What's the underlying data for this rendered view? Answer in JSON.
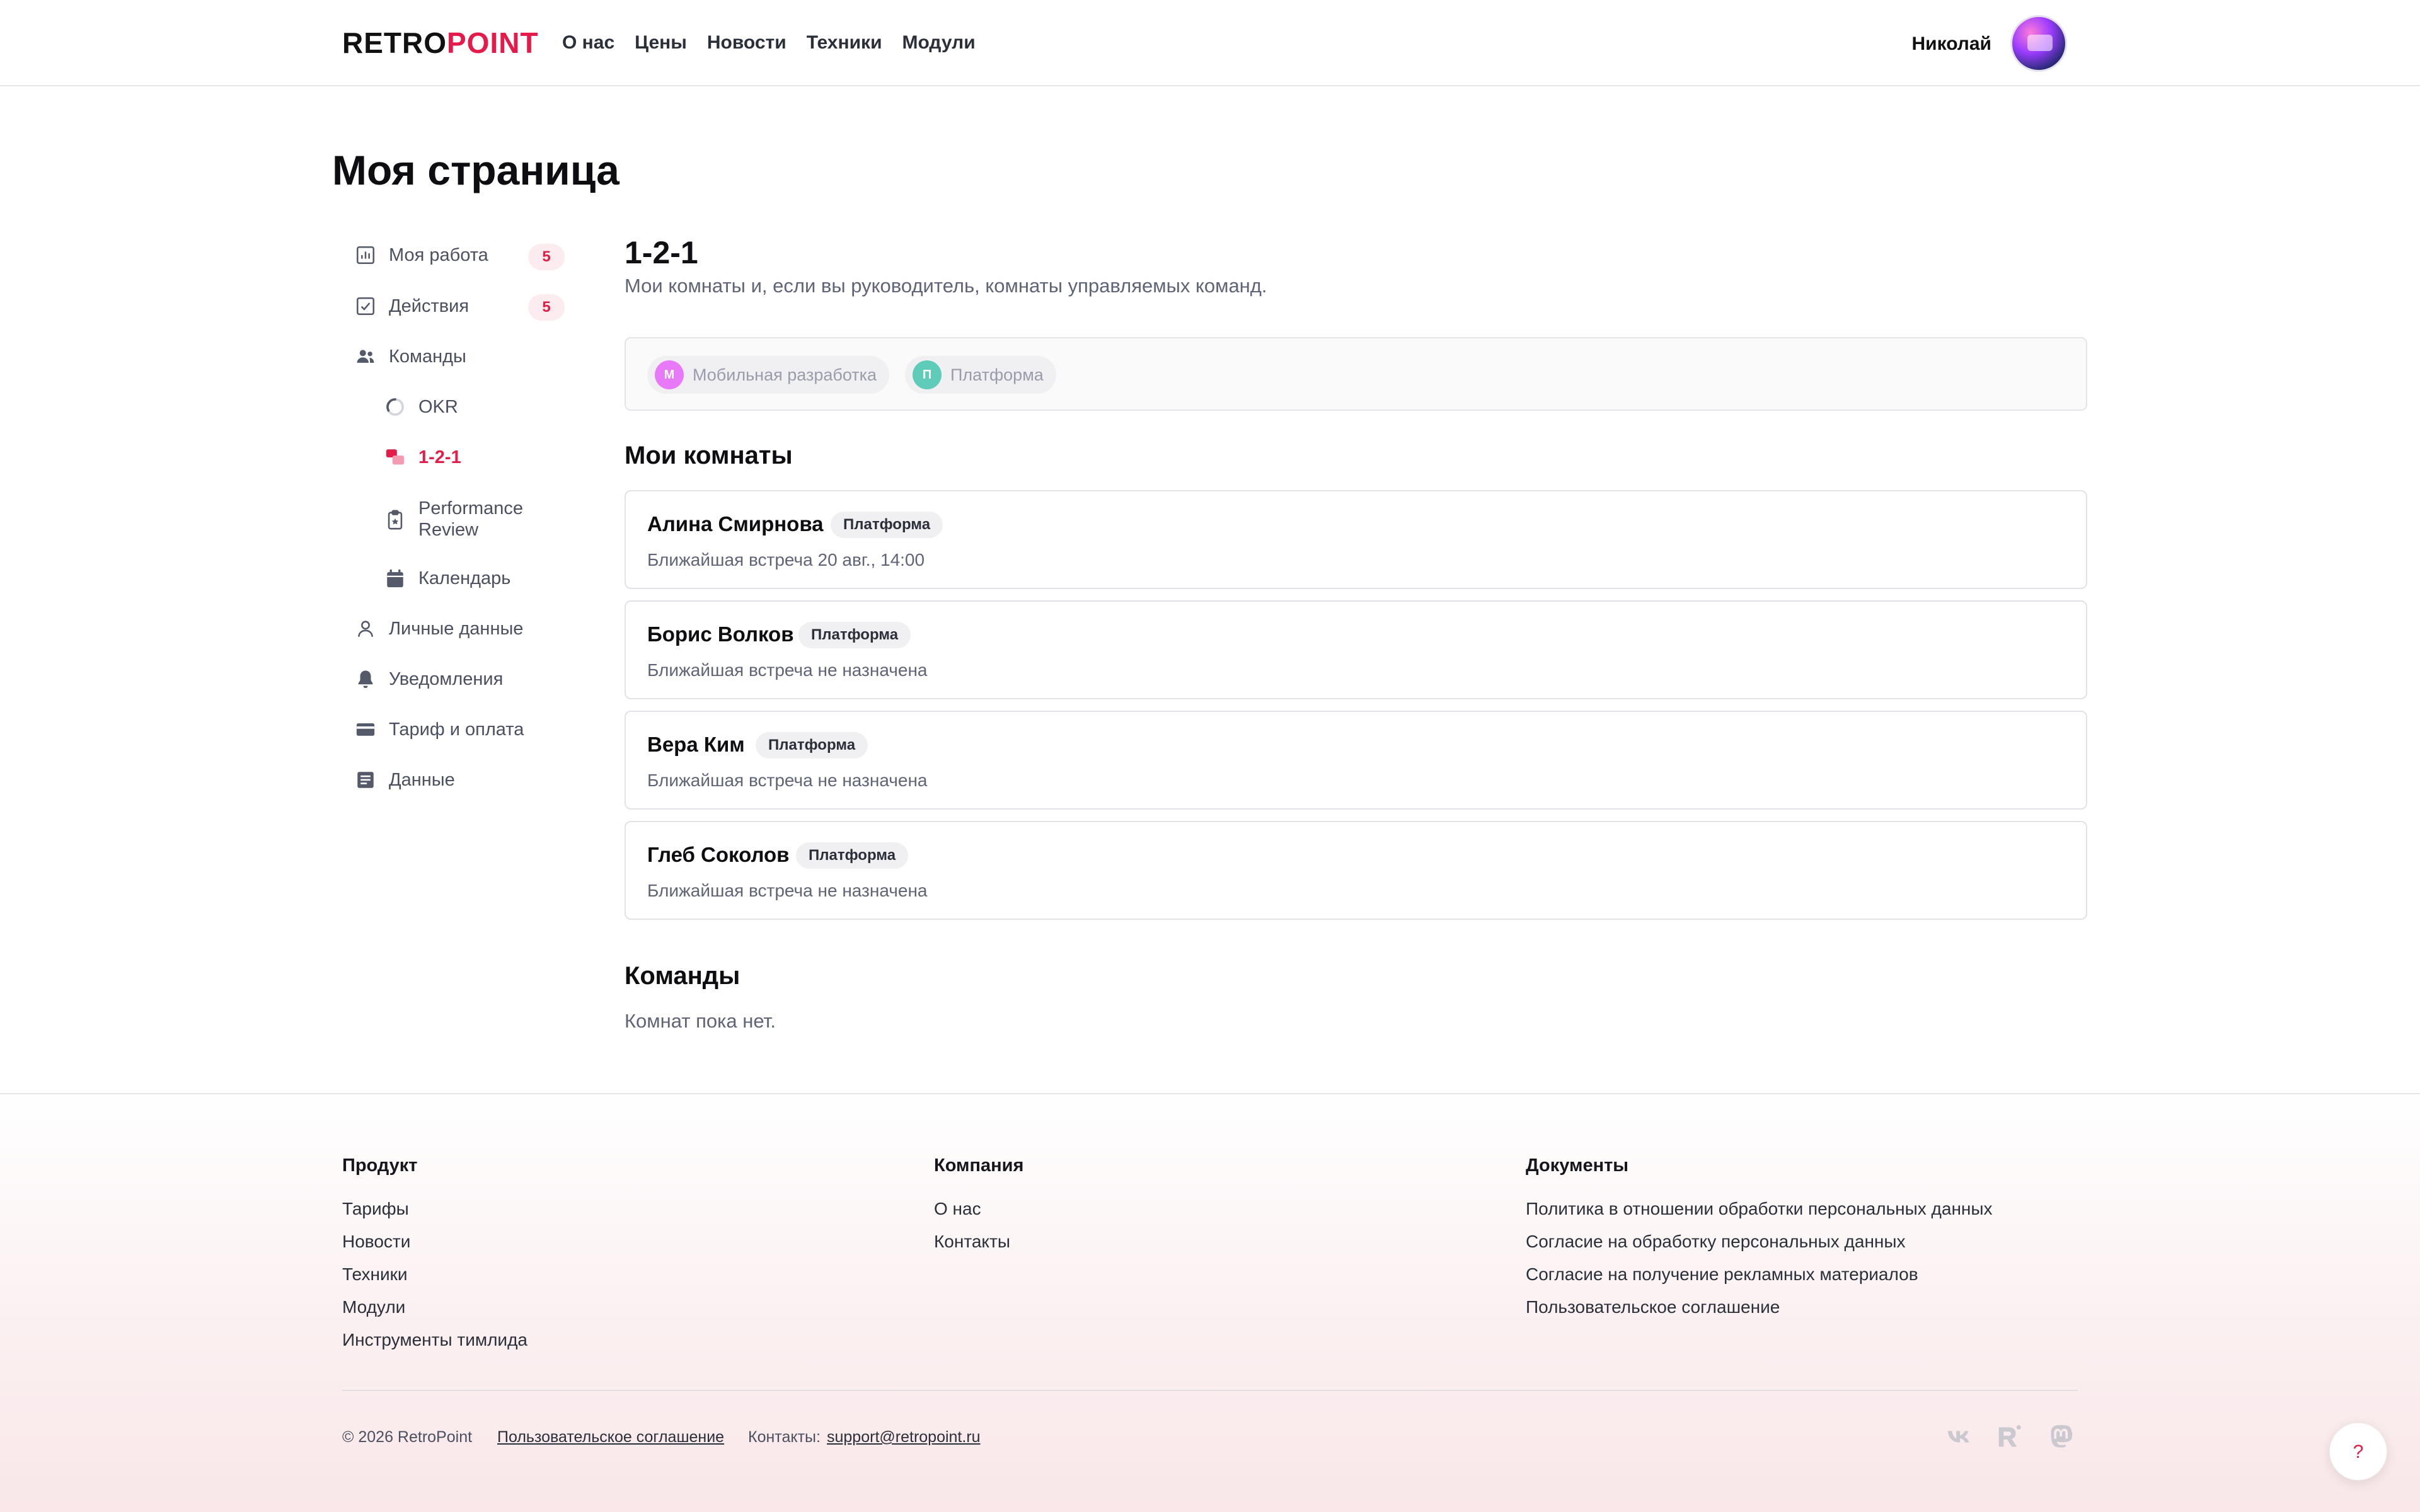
{
  "header": {
    "logo_part1": "RETRO",
    "logo_part2": "POINT",
    "nav": [
      "О нас",
      "Цены",
      "Новости",
      "Техники",
      "Модули"
    ],
    "user_name": "Николай"
  },
  "page_title": "Моя страница",
  "sidebar": {
    "items": [
      {
        "label": "Моя работа",
        "badge": "5",
        "icon": "bar-chart-icon"
      },
      {
        "label": "Действия",
        "badge": "5",
        "icon": "checkbox-icon"
      },
      {
        "label": "Команды",
        "icon": "people-icon"
      },
      {
        "label": "OKR",
        "icon": "progress-ring-icon"
      },
      {
        "label": "1-2-1",
        "icon": "chat-bubbles-icon",
        "active": true
      },
      {
        "label": "Performance Review",
        "icon": "clipboard-star-icon"
      },
      {
        "label": "Календарь",
        "icon": "calendar-icon"
      },
      {
        "label": "Личные данные",
        "icon": "person-icon"
      },
      {
        "label": "Уведомления",
        "icon": "bell-icon"
      },
      {
        "label": "Тариф и оплата",
        "icon": "credit-card-icon"
      },
      {
        "label": "Данные",
        "icon": "document-icon"
      }
    ]
  },
  "main": {
    "title": "1-2-1",
    "description": "Мои комнаты и, если вы руководитель, комнаты управляемых команд.",
    "filters": [
      {
        "initial": "М",
        "label": "Мобильная разработка",
        "color": "#e879f9"
      },
      {
        "initial": "П",
        "label": "Платформа",
        "color": "#5eccb8"
      }
    ],
    "my_rooms_title": "Мои комнаты",
    "rooms": [
      {
        "name": "Алина Смирнова",
        "tag": "Платформа",
        "meeting": "Ближайшая встреча 20 авг., 14:00"
      },
      {
        "name": "Борис Волков",
        "tag": "Платформа",
        "meeting": "Ближайшая встреча не назначена"
      },
      {
        "name": "Вера Ким",
        "tag": "Платформа",
        "meeting": "Ближайшая встреча не назначена"
      },
      {
        "name": "Глеб Соколов",
        "tag": "Платформа",
        "meeting": "Ближайшая встреча не назначена"
      }
    ],
    "teams_title": "Команды",
    "teams_empty": "Комнат пока нет."
  },
  "footer": {
    "product": {
      "title": "Продукт",
      "links": [
        "Тарифы",
        "Новости",
        "Техники",
        "Модули",
        "Инструменты тимлида"
      ]
    },
    "company": {
      "title": "Компания",
      "links": [
        "О нас",
        "Контакты"
      ]
    },
    "documents": {
      "title": "Документы",
      "links": [
        "Политика в отношении обработки персональных данных",
        "Согласие на обработку персональных данных",
        "Согласие на получение рекламных материалов",
        "Пользовательское соглашение"
      ]
    },
    "copyright": "© 2026 RetroPoint",
    "agreement_link": "Пользовательское соглашение",
    "contacts_label": "Контакты:",
    "contacts_email": "support@retropoint.ru",
    "socials": [
      "vk-icon",
      "r-brand-icon",
      "mastodon-icon"
    ],
    "help_label": "?"
  },
  "colors": {
    "accent": "#e11d48",
    "muted_text": "#5f6477"
  }
}
